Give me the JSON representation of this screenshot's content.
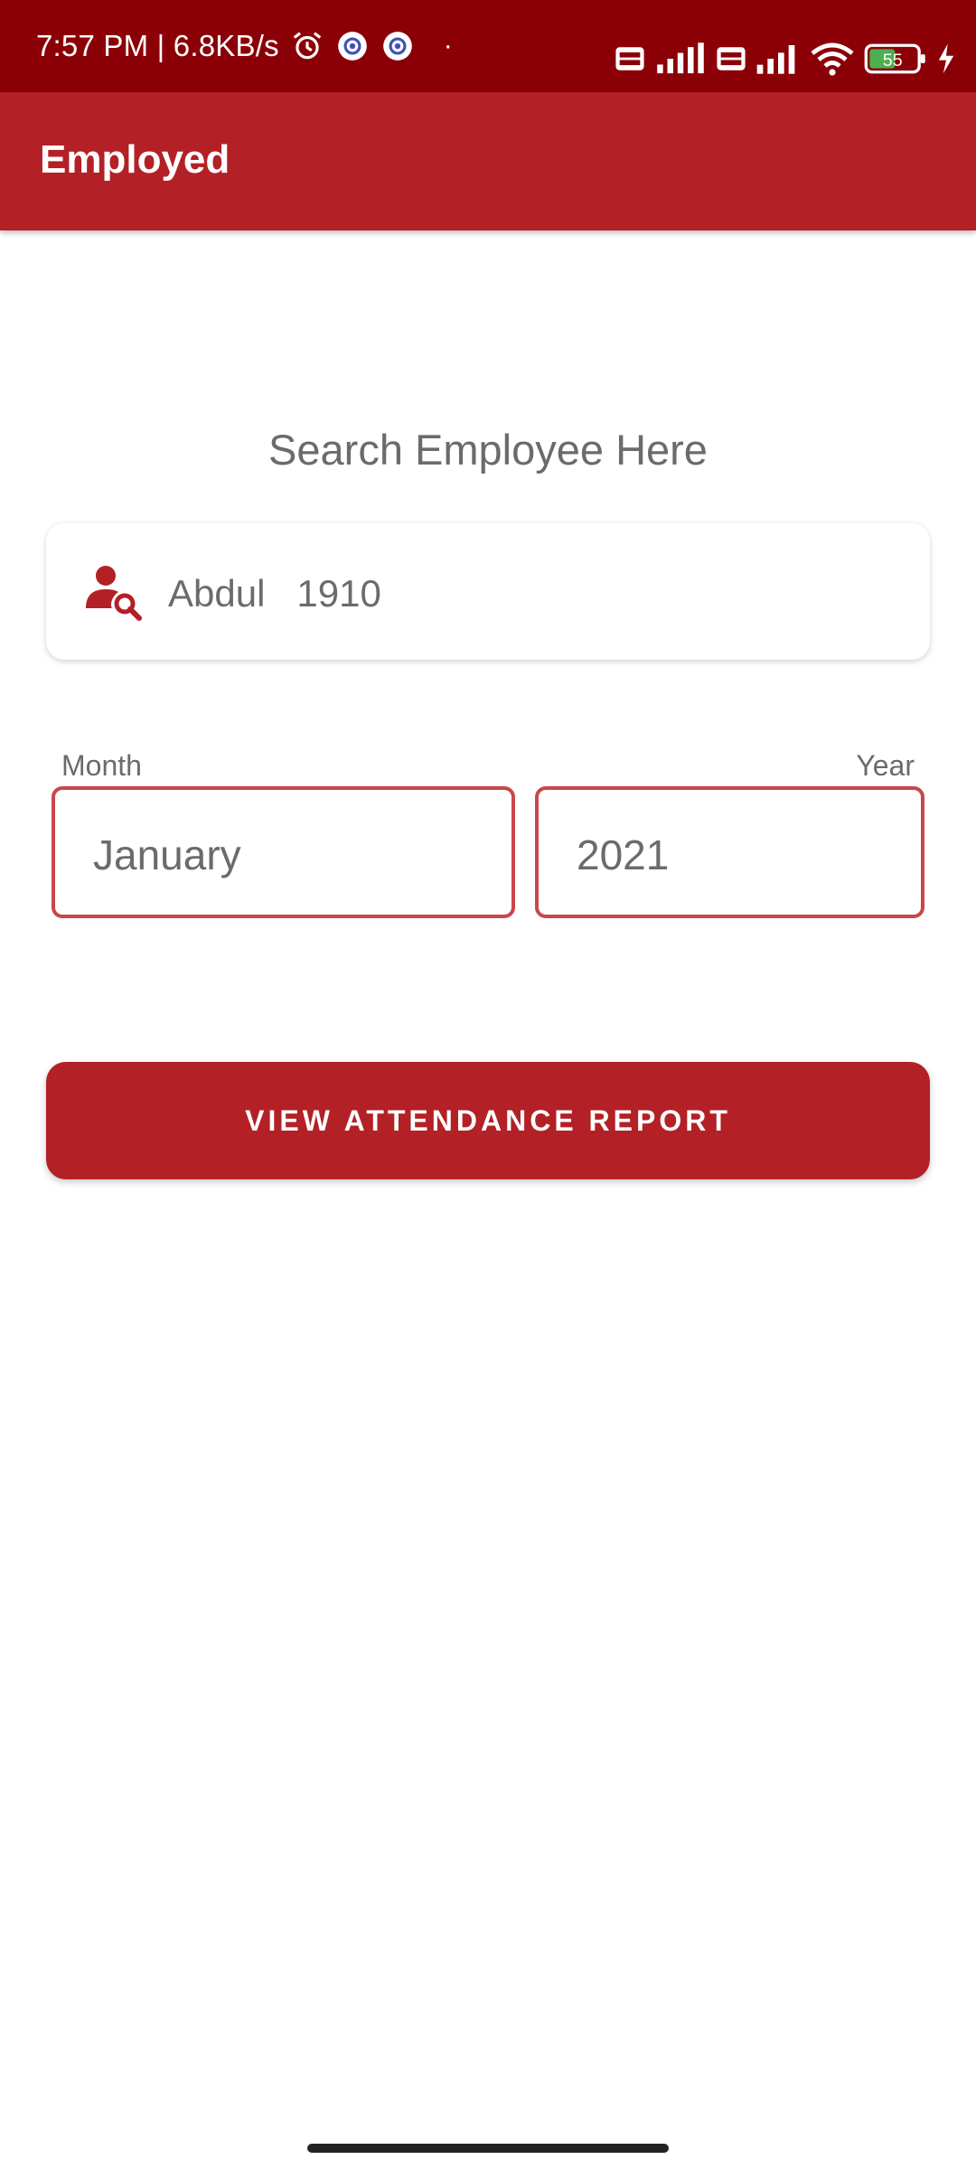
{
  "status_bar": {
    "time": "7:57 PM | 6.8KB/s",
    "dot": "·",
    "battery_level": "55",
    "icons": [
      "alarm-icon",
      "app-notification-icon",
      "app-notification-icon",
      "volte-icon",
      "4g-signal-icon",
      "volte-icon",
      "signal-icon",
      "wifi-icon",
      "battery-icon",
      "charging-icon"
    ]
  },
  "app_bar": {
    "title": "Employed"
  },
  "search": {
    "heading": "Search Employee Here",
    "value": "Abdul   1910",
    "icon": "user-search-icon"
  },
  "month": {
    "label": "Month",
    "value": "January"
  },
  "year": {
    "label": "Year",
    "value": "2021"
  },
  "actions": {
    "report_label": "VIEW ATTENDANCE REPORT"
  },
  "colors": {
    "status_bar": "#8b0007",
    "primary": "#b32025",
    "field_border": "#c9474c",
    "text_grey": "#6b6b6b",
    "battery_fill": "#4caf50"
  }
}
